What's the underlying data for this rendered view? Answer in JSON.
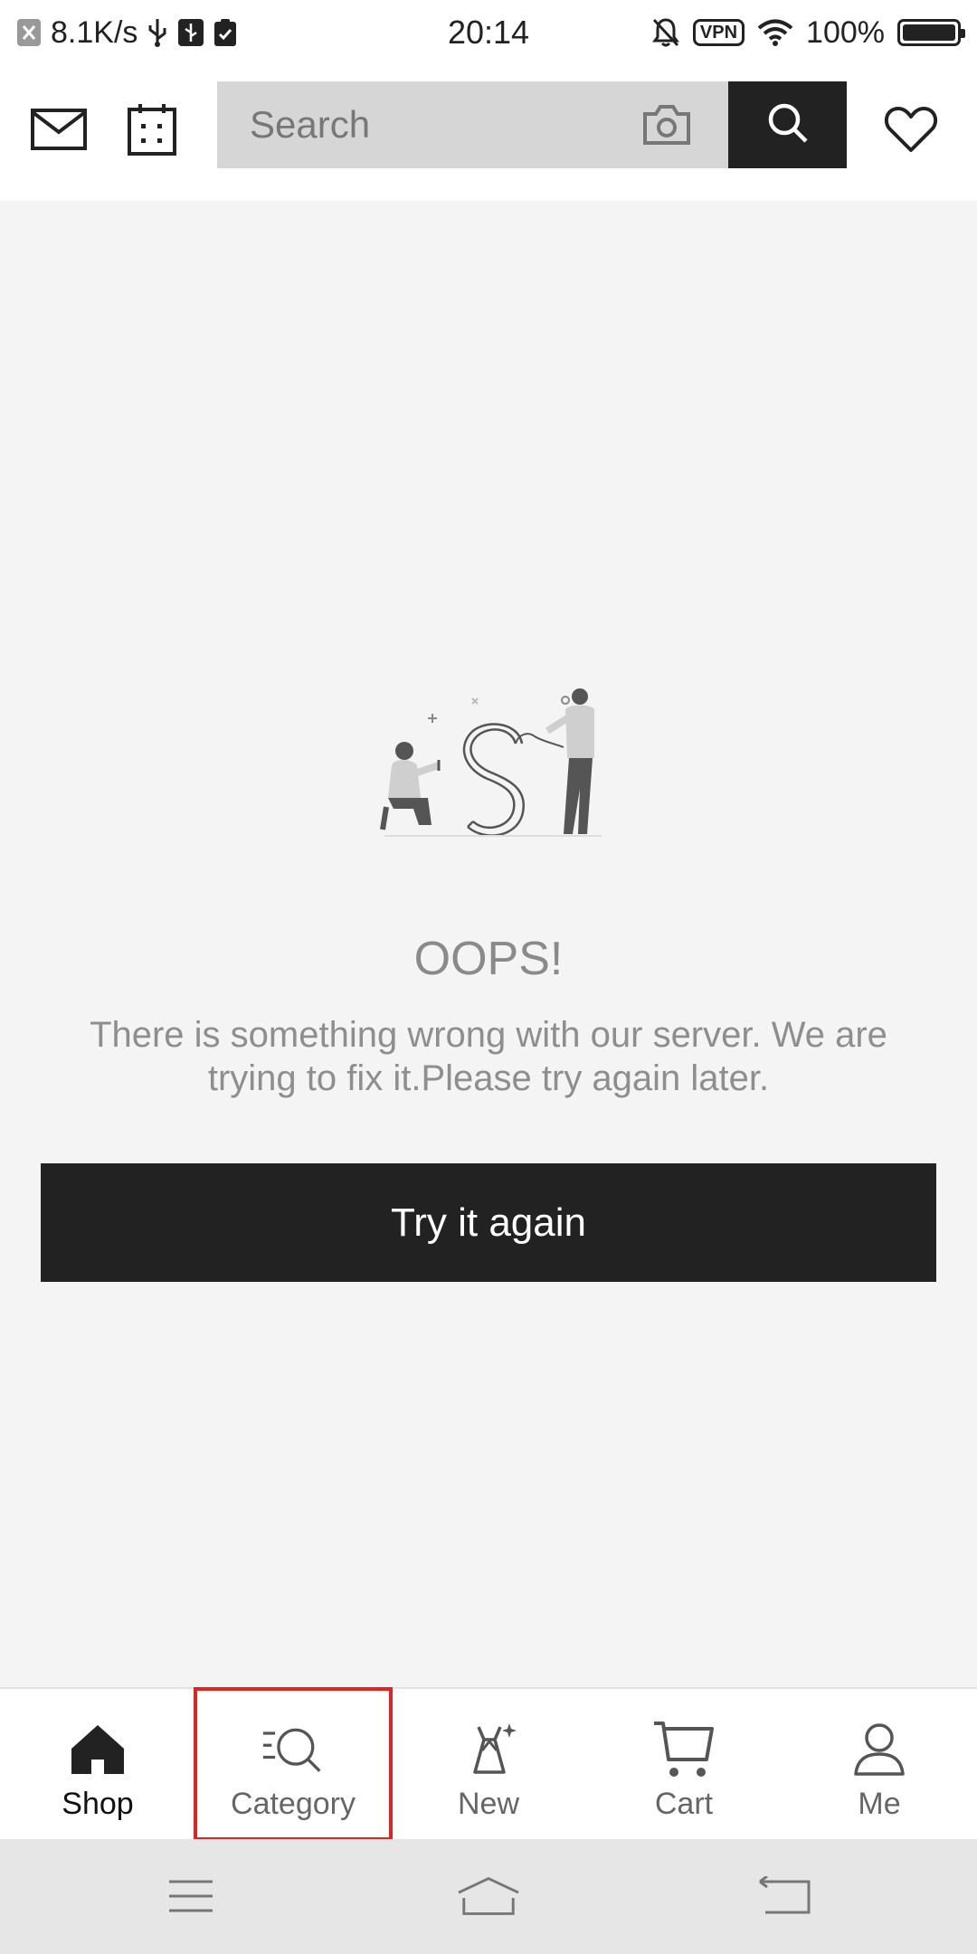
{
  "status_bar": {
    "network_speed": "8.1K/s",
    "time": "20:14",
    "vpn_label": "VPN",
    "battery_percent": "100%"
  },
  "header": {
    "search_placeholder": "Search"
  },
  "error": {
    "title": "OOPS!",
    "message": "There is something wrong with our server. We are trying to fix it.Please try again later.",
    "retry_label": "Try it again"
  },
  "bottom_nav": {
    "items": [
      {
        "label": "Shop",
        "icon": "home-icon",
        "active": true
      },
      {
        "label": "Category",
        "icon": "category-search-icon",
        "active": false
      },
      {
        "label": "New",
        "icon": "dress-icon",
        "active": false
      },
      {
        "label": "Cart",
        "icon": "cart-icon",
        "active": false
      },
      {
        "label": "Me",
        "icon": "profile-icon",
        "active": false
      }
    ]
  },
  "colors": {
    "accent_dark": "#222222",
    "background": "#f4f4f4",
    "highlight": "#e32222"
  }
}
